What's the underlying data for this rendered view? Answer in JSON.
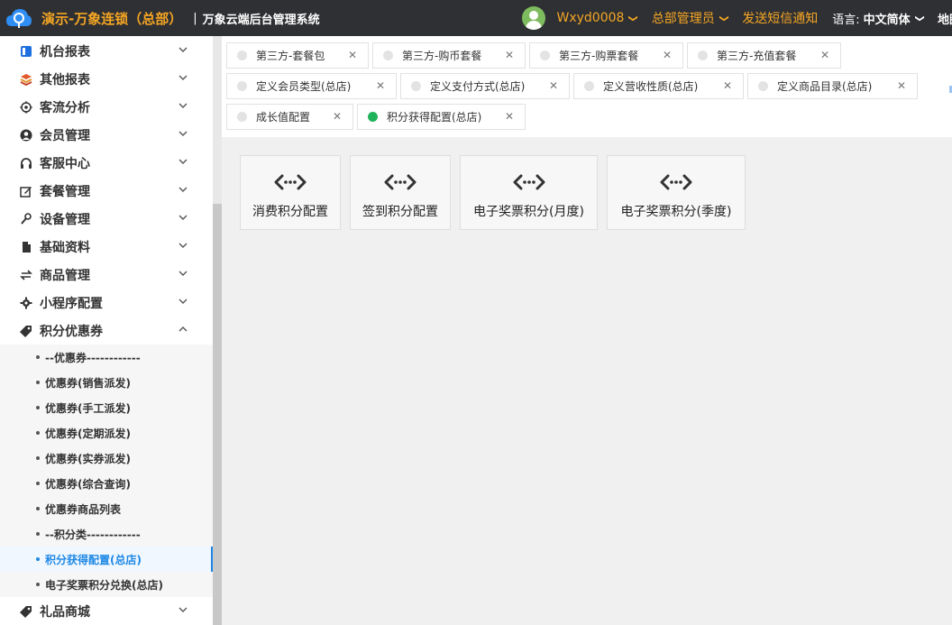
{
  "header": {
    "brand": "演示-万象连锁（总部）",
    "separator": "|",
    "system_name": "万象云端后台管理系统",
    "user_name": "Wxyd0008",
    "role": "总部管理员",
    "sms_link": "发送短信通知",
    "lang_label": "语言:",
    "lang_value": "中文简体",
    "cut_item": "地图"
  },
  "sidebar": {
    "items": [
      {
        "label": "机台报表",
        "icon": "report-icon"
      },
      {
        "label": "其他报表",
        "icon": "layers-icon"
      },
      {
        "label": "客流分析",
        "icon": "target-icon"
      },
      {
        "label": "会员管理",
        "icon": "user-icon"
      },
      {
        "label": "客服中心",
        "icon": "headset-icon"
      },
      {
        "label": "套餐管理",
        "icon": "edit-icon"
      },
      {
        "label": "设备管理",
        "icon": "wrench-icon"
      },
      {
        "label": "基础资料",
        "icon": "file-icon"
      },
      {
        "label": "商品管理",
        "icon": "swap-icon"
      },
      {
        "label": "小程序配置",
        "icon": "gear-icon"
      },
      {
        "label": "积分优惠券",
        "icon": "tag-icon"
      }
    ],
    "sub_items": [
      "--优惠券------------",
      "优惠券(销售派发)",
      "优惠券(手工派发)",
      "优惠券(定期派发)",
      "优惠券(实券派发)",
      "优惠券(综合查询)",
      "优惠券商品列表",
      "--积分类------------",
      "积分获得配置(总店)",
      "电子奖票积分兑换(总店)"
    ],
    "last_item": {
      "label": "礼品商城",
      "icon": "tag-icon"
    }
  },
  "tabs": [
    "第三方-套餐包",
    "第三方-购币套餐",
    "第三方-购票套餐",
    "第三方-充值套餐",
    "定义会员类型(总店)",
    "定义支付方式(总店)",
    "定义营收性质(总店)",
    "定义商品目录(总店)",
    "成长值配置",
    "积分获得配置(总店)"
  ],
  "active_tab": "积分获得配置(总店)",
  "cards": [
    "消费积分配置",
    "签到积分配置",
    "电子奖票积分(月度)",
    "电子奖票积分(季度)"
  ],
  "colors": {
    "header_bg": "#2f3034",
    "brand": "#f5a623",
    "active_blue": "#1e88e5",
    "active_tab_dot": "#21b35c"
  }
}
